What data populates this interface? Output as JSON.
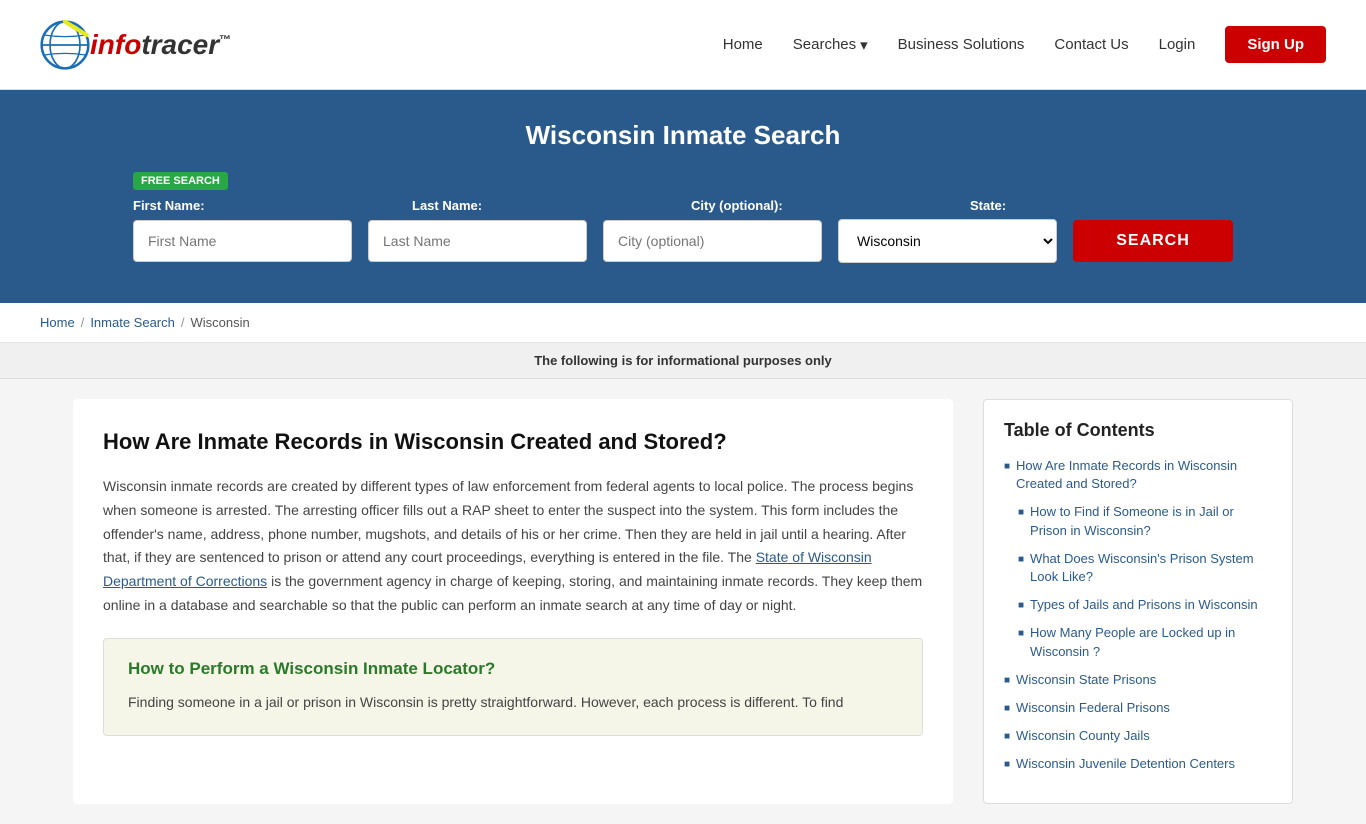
{
  "header": {
    "logo_text_info": "info",
    "logo_text_tracer": "tracer",
    "logo_tm": "™",
    "nav": {
      "home": "Home",
      "searches": "Searches",
      "searches_chevron": "▾",
      "business_solutions": "Business Solutions",
      "contact_us": "Contact Us",
      "login": "Login",
      "signup": "Sign Up"
    }
  },
  "hero": {
    "title": "Wisconsin Inmate Search",
    "free_search_badge": "FREE SEARCH",
    "form": {
      "first_name_label": "First Name:",
      "last_name_label": "Last Name:",
      "city_label": "City (optional):",
      "state_label": "State:",
      "first_name_placeholder": "First Name",
      "last_name_placeholder": "Last Name",
      "city_placeholder": "City (optional)",
      "state_value": "Wisconsin",
      "search_btn": "SEARCH"
    }
  },
  "breadcrumb": {
    "home": "Home",
    "inmate_search": "Inmate Search",
    "current": "Wisconsin"
  },
  "info_bar": {
    "text": "The following is for informational purposes only"
  },
  "article": {
    "title": "How Are Inmate Records in Wisconsin Created and Stored?",
    "body_p1": "Wisconsin inmate records are created by different types of law enforcement from federal agents to local police. The process begins when someone is arrested. The arresting officer fills out a RAP sheet to enter the suspect into the system. This form includes the offender's name, address, phone number, mugshots, and details of his or her crime. Then they are held in jail until a hearing. After that, if they are sentenced to prison or attend any court proceedings, everything is entered in the file. The",
    "body_link": "State of Wisconsin Department of Corrections",
    "body_p1_cont": "is the government agency in charge of keeping, storing, and maintaining inmate records. They keep them online in a database and searchable so that the public can perform an inmate search at any time of day or night.",
    "howto_title": "How to Perform a Wisconsin Inmate Locator?",
    "howto_text": "Finding someone in a jail or prison in Wisconsin is pretty straightforward. However, each process is different. To find"
  },
  "toc": {
    "title": "Table of Contents",
    "items": [
      {
        "text": "How Are Inmate Records in Wisconsin Created and Stored?",
        "sub": false
      },
      {
        "text": "How to Find if Someone is in Jail or Prison in Wisconsin?",
        "sub": true
      },
      {
        "text": "What Does Wisconsin's Prison System Look Like?",
        "sub": true
      },
      {
        "text": "Types of Jails and Prisons in Wisconsin",
        "sub": true
      },
      {
        "text": "How Many People are Locked up in Wisconsin ?",
        "sub": true
      },
      {
        "text": "Wisconsin State Prisons",
        "sub": false
      },
      {
        "text": "Wisconsin Federal Prisons",
        "sub": false
      },
      {
        "text": "Wisconsin County Jails",
        "sub": false
      },
      {
        "text": "Wisconsin Juvenile Detention Centers",
        "sub": false
      }
    ]
  }
}
